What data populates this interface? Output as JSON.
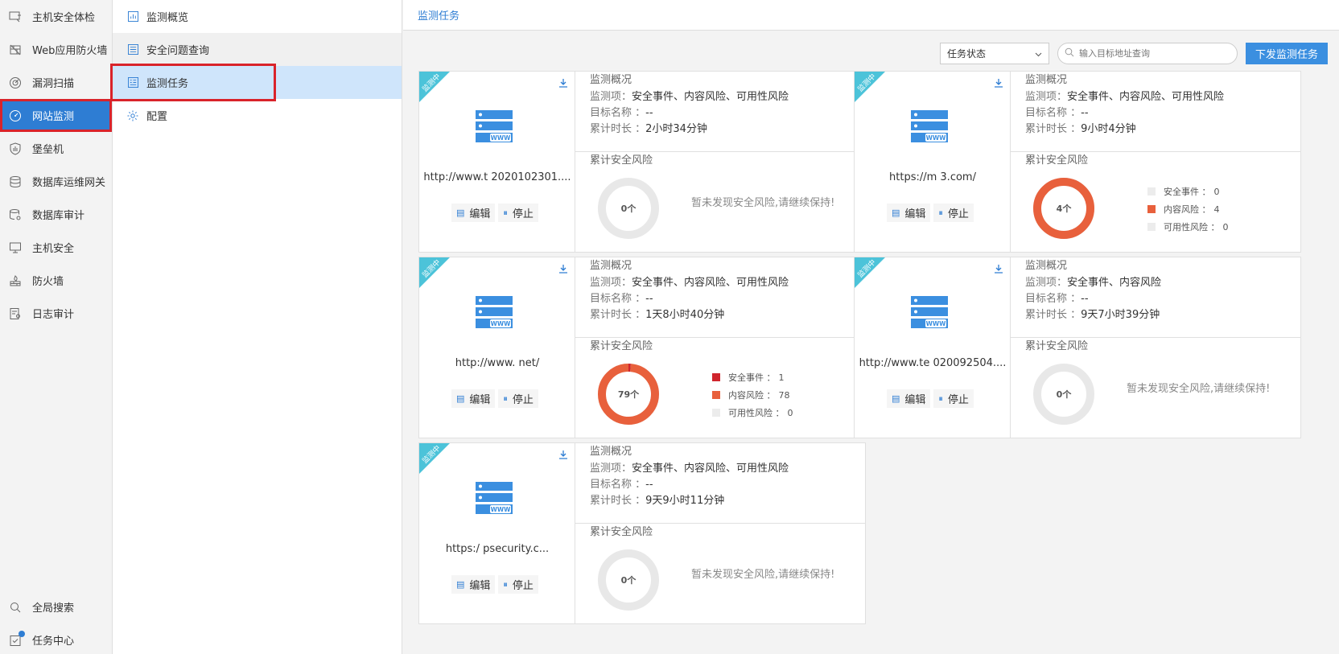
{
  "nav": {
    "items": [
      {
        "label": "主机安全体检",
        "icon": "host-check-icon"
      },
      {
        "label": "Web应用防火墙",
        "icon": "waf-icon"
      },
      {
        "label": "漏洞扫描",
        "icon": "vuln-scan-icon"
      },
      {
        "label": "网站监测",
        "icon": "site-monitor-icon"
      },
      {
        "label": "堡垒机",
        "icon": "bastion-icon"
      },
      {
        "label": "数据库运维网关",
        "icon": "db-gateway-icon"
      },
      {
        "label": "数据库审计",
        "icon": "db-audit-icon"
      },
      {
        "label": "主机安全",
        "icon": "host-security-icon"
      },
      {
        "label": "防火墙",
        "icon": "firewall-icon"
      },
      {
        "label": "日志审计",
        "icon": "log-audit-icon"
      }
    ],
    "bottom": [
      {
        "label": "全局搜索",
        "icon": "search-icon"
      },
      {
        "label": "任务中心",
        "icon": "task-center-icon"
      }
    ]
  },
  "subnav": {
    "items": [
      {
        "label": "监测概览",
        "icon": "chart-icon"
      },
      {
        "label": "安全问题查询",
        "icon": "list-icon"
      },
      {
        "label": "监测任务",
        "icon": "task-list-icon"
      },
      {
        "label": "配置",
        "icon": "settings-icon"
      }
    ]
  },
  "breadcrumb": "监测任务",
  "toolbar": {
    "status_select": "任务状态",
    "search_placeholder": "输入目标地址查询",
    "issue_button": "下发监测任务"
  },
  "colors": {
    "accent": "#2e7dd3",
    "risk_content": "#e8603c",
    "risk_security": "#d0252d",
    "risk_avail": "#e8e8e8",
    "ribbon": "#4cc3d9"
  },
  "labels": {
    "ribbon": "监测中",
    "overview": "监测概况",
    "items_key": "监测项：",
    "target_key": "目标名称 ：",
    "duration_key": "累计时长 ：",
    "risk_title": "累计安全风险",
    "no_risk": "暂未发现安全风险,请继续保持!",
    "edit": "编辑",
    "stop": "停止",
    "legend_security": "安全事件 ：",
    "legend_content": "内容风险 ：",
    "legend_avail": "可用性风险 ："
  },
  "cards": [
    {
      "url": "http://www.t 2020102301....",
      "items": "安全事件、内容风险、可用性风险",
      "target": "--",
      "duration": "2小时34分钟",
      "total": "0个",
      "security": 0,
      "content": 0,
      "avail": 0,
      "has_risk": false
    },
    {
      "url": "https://m 3.com/",
      "items": "安全事件、内容风险、可用性风险",
      "target": "--",
      "duration": "9小时4分钟",
      "total": "4个",
      "security": 0,
      "content": 4,
      "avail": 0,
      "has_risk": true
    },
    {
      "url": "http://www. net/",
      "items": "安全事件、内容风险、可用性风险",
      "target": "--",
      "duration": "1天8小时40分钟",
      "total": "79个",
      "security": 1,
      "content": 78,
      "avail": 0,
      "has_risk": true
    },
    {
      "url": "http://www.te 020092504....",
      "items": "安全事件、内容风险",
      "target": "--",
      "duration": "9天7小时39分钟",
      "total": "0个",
      "security": 0,
      "content": 0,
      "avail": 0,
      "has_risk": false
    },
    {
      "url": "https:/ psecurity.c...",
      "items": "安全事件、内容风险、可用性风险",
      "target": "--",
      "duration": "9天9小时11分钟",
      "total": "0个",
      "security": 0,
      "content": 0,
      "avail": 0,
      "has_risk": false
    }
  ]
}
